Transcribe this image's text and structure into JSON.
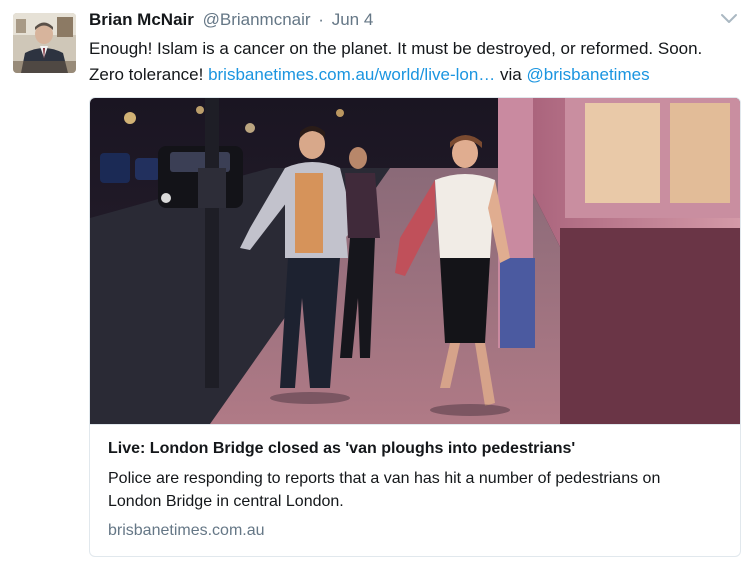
{
  "tweet": {
    "author_name": "Brian McNair",
    "handle": "@Brianmcnair",
    "separator": "·",
    "date": "Jun 4",
    "text_main": "Enough! Islam is a cancer on the planet. It must be destroyed, or reformed. Soon. Zero tolerance! ",
    "link_text": "brisbanetimes.com.au/world/live-lon…",
    "via_text": " via ",
    "via_handle": "@brisbanetimes"
  },
  "card": {
    "title": "Live: London Bridge closed as 'van ploughs into pedestrians'",
    "description": "Police are responding to reports that a van has hit a number of pedestrians on London Bridge in central London.",
    "domain": "brisbanetimes.com.au"
  },
  "colors": {
    "link": "#1b95e0",
    "muted": "#657786",
    "text": "#14171a",
    "border": "#e1e8ed"
  },
  "icons": {
    "more": "chevron-down-icon"
  }
}
